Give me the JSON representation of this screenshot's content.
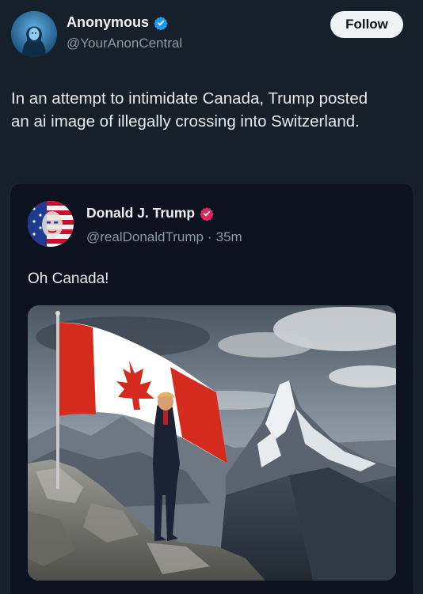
{
  "post": {
    "author": {
      "display_name": "Anonymous",
      "handle": "@YourAnonCentral",
      "verified": true
    },
    "follow_label": "Follow",
    "text": "In an attempt to intimidate Canada, Trump posted an ai image of illegally crossing into Switzerland."
  },
  "quoted_post": {
    "author": {
      "display_name": "Donald J. Trump",
      "handle": "@realDonaldTrump",
      "verified": true
    },
    "separator": "·",
    "time": "35m",
    "text": "Oh Canada!",
    "image_icon": "image"
  },
  "colors": {
    "background": "#15202b",
    "card": "#0d1220",
    "verified_blue": "#1d9bf0",
    "verified_pink": "#e0245e",
    "flag_red": "#d52b1e"
  }
}
